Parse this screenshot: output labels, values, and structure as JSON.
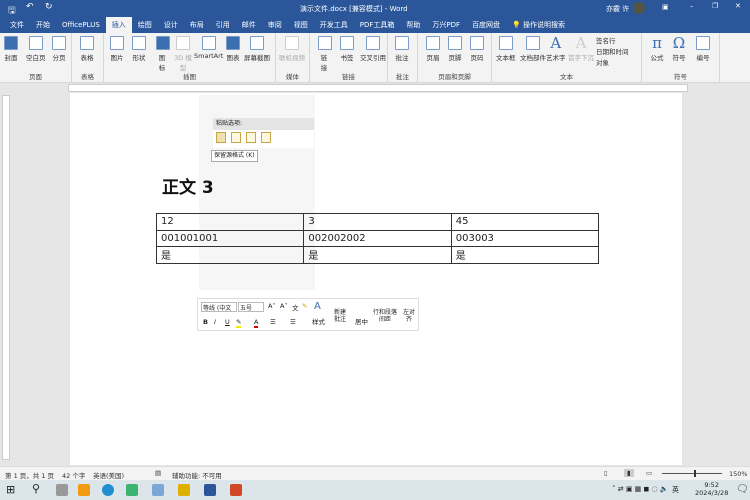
{
  "titlebar": {
    "title": "演示文件.docx [兼容模式] - Word",
    "user": "亦霰 许"
  },
  "tabs": [
    "文件",
    "开始",
    "OfficePLUS",
    "插入",
    "绘图",
    "设计",
    "布局",
    "引用",
    "邮件",
    "审阅",
    "视图",
    "开发工具",
    "PDF工具箱",
    "帮助",
    "万兴PDF",
    "百度网盘",
    "操作说明搜索"
  ],
  "active_tab": "插入",
  "ribbon": {
    "groups": [
      {
        "label": "页面",
        "buttons": [
          "封面",
          "空白页",
          "分页"
        ]
      },
      {
        "label": "表格",
        "buttons": [
          "表格"
        ]
      },
      {
        "label": "插图",
        "buttons": [
          "图片",
          "形状",
          "图标",
          "3D 模型",
          "SmartArt",
          "图表",
          "屏幕截图"
        ]
      },
      {
        "label": "媒体",
        "buttons": [
          "联机视频"
        ]
      },
      {
        "label": "链接",
        "buttons": [
          "链接",
          "书签",
          "交叉引用"
        ]
      },
      {
        "label": "批注",
        "buttons": [
          "批注"
        ]
      },
      {
        "label": "页眉和页脚",
        "buttons": [
          "页眉",
          "页脚",
          "页码"
        ]
      },
      {
        "label": "文本",
        "buttons": [
          "文本框",
          "文档部件",
          "艺术字",
          "首字下沉",
          "签名行",
          "日期和时间",
          "对象"
        ]
      },
      {
        "label": "符号",
        "buttons": [
          "公式",
          "符号",
          "编号"
        ]
      }
    ]
  },
  "document": {
    "heading": "正文 3",
    "table": [
      [
        "12",
        "3",
        "45"
      ],
      [
        "001001001",
        "002002002",
        "003003"
      ],
      [
        "是",
        "是",
        "是"
      ]
    ]
  },
  "paste_popup": {
    "title": "粘贴选项:",
    "tooltip": "保留源格式 (K)"
  },
  "mini_toolbar": {
    "font": "等线 (中文",
    "size": "五号",
    "bold": "B",
    "italic": "I",
    "underline": "U",
    "styles": "样式",
    "new_comment": "新建批注",
    "center": "居中",
    "line_spacing": "行和段落间距",
    "align_left": "左对齐"
  },
  "status": {
    "page": "第 1 页，共 1 页",
    "words": "42 个字",
    "lang": "英语(美国)",
    "accessibility": "辅助功能: 不可用",
    "zoom": "150%"
  },
  "taskbar": {
    "ime": "英",
    "time": "9:52",
    "date": "2024/3/28"
  },
  "colors": {
    "accent": "#2b579a"
  }
}
